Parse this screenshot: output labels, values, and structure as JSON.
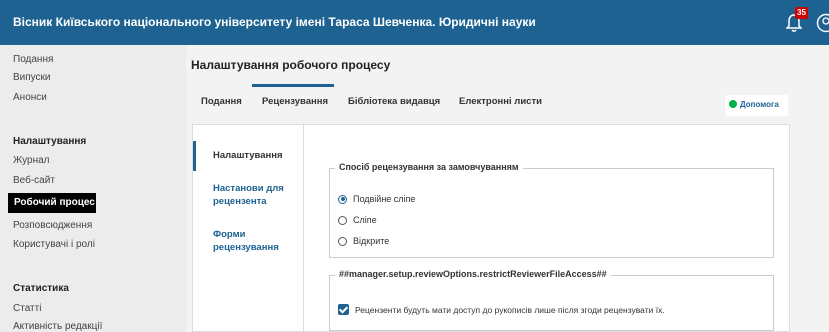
{
  "header": {
    "title": "Вісник Київського національного університету імені Тараса Шевченка. Юридичні науки",
    "notification_count": "35",
    "icons": [
      "bell-icon",
      "user-icon"
    ]
  },
  "sidebar": {
    "items": [
      "Подання",
      "Випуски",
      "Анонси"
    ],
    "settings_heading": "Налаштування",
    "settings_items": [
      "Журнал",
      "Веб-сайт",
      "Робочий процес",
      "Розповсюдження",
      "Користувачі і ролі"
    ],
    "active_item": "Робочий процес",
    "stats_heading": "Статистика",
    "stats_items": [
      "Статті",
      "Активність редакції"
    ]
  },
  "main": {
    "title": "Налаштування робочого процесу",
    "tabs": [
      "Подання",
      "Рецензування",
      "Бібліотека видавця",
      "Електронні листи"
    ],
    "active_tab": "Рецензування",
    "help_label": "Допомога",
    "help_icon": "help-dot-icon",
    "accent_color": "#1e6292",
    "subnav": [
      "Налаштування",
      "Настанови для рецензента",
      "Форми рецензування"
    ],
    "active_subnav": "Налаштування",
    "review_method": {
      "legend": "Спосіб рецензування за замовчуванням",
      "options": [
        "Подвійне сліпе",
        "Сліпе",
        "Відкрите"
      ],
      "selected": "Подвійне сліпе"
    },
    "file_access": {
      "legend": "##manager.setup.reviewOptions.restrictReviewerFileAccess##",
      "checkbox_label": "Рецензенти будуть мати доступ до рукописів лише після згоди рецензувати їх.",
      "checked": true
    }
  }
}
